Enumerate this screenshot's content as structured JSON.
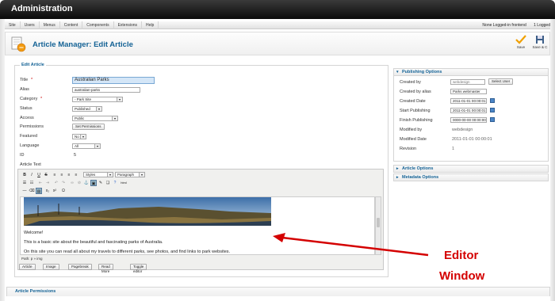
{
  "app": {
    "title": "Administration"
  },
  "menu": {
    "items": [
      "Site",
      "Users",
      "Menus",
      "Content",
      "Components",
      "Extensions",
      "Help"
    ],
    "status_logged": "None Logged-in frontend",
    "status_user": "1 Logged"
  },
  "toolbar": {
    "title": "Article Manager: Edit Article",
    "save": "Save",
    "save_close": "Save & C"
  },
  "edit": {
    "legend": "Edit Article",
    "title_label": "Title",
    "title_value": "Australian Parks",
    "alias_label": "Alias",
    "alias_value": "australian-parks",
    "category_label": "Category",
    "category_value": "- Park Site",
    "status_label": "Status",
    "status_value": "Published",
    "access_label": "Access",
    "access_value": "Public",
    "permissions_label": "Permissions",
    "permissions_button": "Set Permissions",
    "featured_label": "Featured",
    "featured_value": "No",
    "language_label": "Language",
    "language_value": "All",
    "id_label": "ID",
    "id_value": "5",
    "article_text_label": "Article Text",
    "required_mark": "*"
  },
  "editor": {
    "styles": "Styles",
    "format": "Paragraph",
    "welcome": "Welcome!",
    "line1": "This is a basic site about the beautiful and fascinating parks of Australia.",
    "line2": "On this site you can read all about my travels to different parks, see photos, and find links to park websites.",
    "path": "Path: p » img",
    "buttons": [
      "Article",
      "Image",
      "Pagebreak",
      "Read More",
      "Toggle editor"
    ]
  },
  "publishing": {
    "header": "Publishing Options",
    "created_by_label": "Created by",
    "created_by_value": "webdesign",
    "select_user": "Select User",
    "alias_label": "Created by alias",
    "alias_value": "Parks webmaster",
    "created_date_label": "Created Date",
    "created_date_value": "2011-01-01 00:00:01",
    "start_label": "Start Publishing",
    "start_value": "2011-01-01 00:00:01",
    "finish_label": "Finish Publishing",
    "finish_value": "0000-00-00 00:00:00",
    "modified_by_label": "Modified by",
    "modified_by_value": "webdesign",
    "modified_date_label": "Modified Date",
    "modified_date_value": "2011-01-01 00:00:01",
    "revision_label": "Revision",
    "revision_value": "1"
  },
  "panels": {
    "article_options": "Article Options",
    "metadata_options": "Metadata Options",
    "permissions": "Article Permissions"
  },
  "annotation": {
    "line1": "Editor",
    "line2": "Window"
  },
  "colors": {
    "accent": "#146295",
    "annotation": "#d40000",
    "titlebar": "#1a1a1a"
  }
}
